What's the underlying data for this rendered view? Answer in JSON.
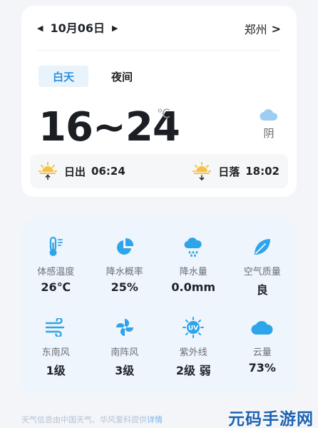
{
  "header": {
    "date": "10月06日",
    "city": "郑州"
  },
  "tabs": [
    {
      "label": "白天",
      "active": true
    },
    {
      "label": "夜间",
      "active": false
    }
  ],
  "temperature": {
    "range": "16~24",
    "unit": "℃",
    "condition": "阴"
  },
  "sun": {
    "sunrise_label": "日出",
    "sunrise_time": "06:24",
    "sunset_label": "日落",
    "sunset_time": "18:02"
  },
  "details": [
    {
      "icon": "thermometer-icon",
      "label": "体感温度",
      "value": "26℃"
    },
    {
      "icon": "pie-chart-icon",
      "label": "降水概率",
      "value": "25%"
    },
    {
      "icon": "rain-cloud-icon",
      "label": "降水量",
      "value": "0.0mm"
    },
    {
      "icon": "leaf-icon",
      "label": "空气质量",
      "value": "良"
    },
    {
      "icon": "wind-icon",
      "label": "东南风",
      "value": "1级"
    },
    {
      "icon": "pinwheel-icon",
      "label": "南阵风",
      "value": "3级"
    },
    {
      "icon": "uv-sun-icon",
      "label": "紫外线",
      "value": "2级 弱"
    },
    {
      "icon": "cloud-icon",
      "label": "云量",
      "value": "73%"
    }
  ],
  "footer": {
    "text": "天气信息由中国天气、华风爱科提供",
    "link": "详情"
  },
  "watermark": "元码手游网",
  "colors": {
    "accent": "#2b8fde",
    "tab_active_bg": "#e8f3fc",
    "sun_icon": "#f5c243",
    "detail_icon": "#2ea4ea",
    "detail_card_bg": "#eef5fc"
  }
}
